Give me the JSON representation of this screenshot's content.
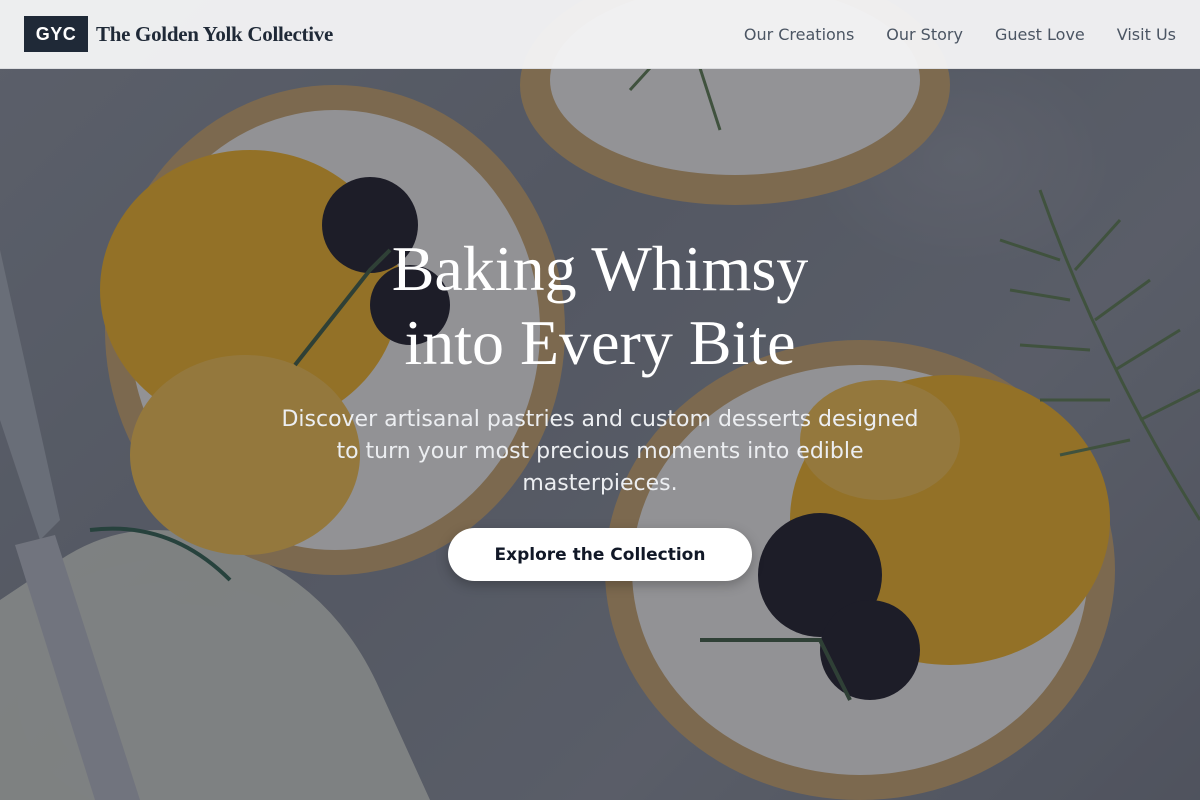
{
  "brand": {
    "mark": "GYC",
    "name": "The Golden Yolk Collective"
  },
  "nav": {
    "items": [
      {
        "label": "Our Creations"
      },
      {
        "label": "Our Story"
      },
      {
        "label": "Guest Love"
      },
      {
        "label": "Visit Us"
      }
    ]
  },
  "hero": {
    "title_line1": "Baking Whimsy",
    "title_line2": "into Every Bite",
    "subtitle": "Discover artisanal pastries and custom desserts designed to turn your most precious moments into edible masterpieces.",
    "cta_label": "Explore the Collection"
  },
  "colors": {
    "brand_mark_bg": "#1f2937",
    "header_bg": "#f4f4f5",
    "nav_text": "#4b5563",
    "cta_bg": "#ffffff",
    "cta_text": "#111827",
    "overlay": "#1e222e"
  }
}
